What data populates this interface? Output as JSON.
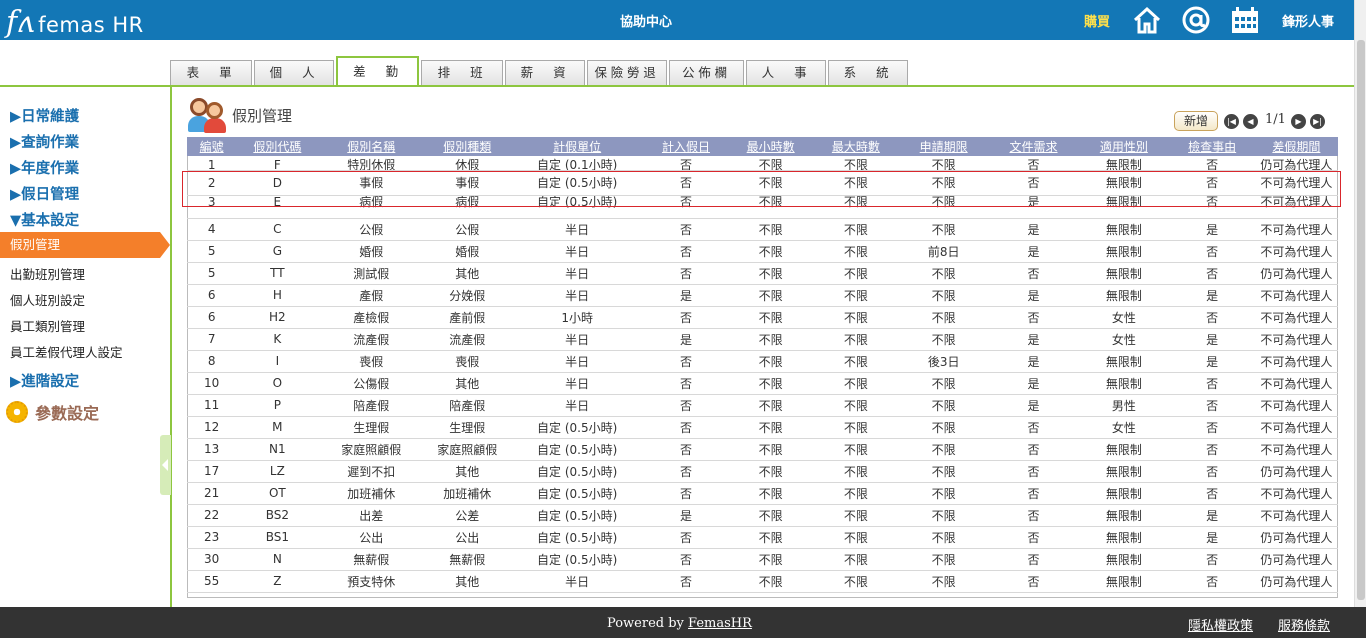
{
  "header": {
    "logo_mark": "fʌ",
    "logo_text": "femas HR",
    "help_center": "協助中心",
    "buy": "購買",
    "company": "鋒形人事"
  },
  "tabs": [
    "表　單",
    "個　人",
    "差　勤",
    "排　班",
    "薪　資",
    "保險勞退",
    "公佈欄",
    "人　事",
    "系　統"
  ],
  "sidebar": {
    "menus": [
      "▶日常維護",
      "▶查詢作業",
      "▶年度作業",
      "▶假日管理",
      "▼基本設定"
    ],
    "subs": [
      "假別管理",
      "出勤班別管理",
      "個人班別設定",
      "員工類別管理",
      "員工差假代理人設定"
    ],
    "advanced": "▶進階設定",
    "params": "參數設定"
  },
  "main": {
    "title": "假別管理",
    "add_button": "新增",
    "page_indicator": "1/1",
    "pager_icons": [
      "first-page-icon",
      "prev-page-icon",
      "next-page-icon",
      "last-page-icon"
    ]
  },
  "table": {
    "headers": [
      "編號",
      "假別代碼",
      "假別名稱",
      "假別種類",
      "計假單位",
      "計入假日",
      "最小時數",
      "最大時數",
      "申請期限",
      "文件需求",
      "適用性別",
      "檢查事由",
      "差假期間"
    ],
    "rows": [
      [
        "1",
        "F",
        "特別休假",
        "休假",
        "自定 (0.1小時)",
        "否",
        "不限",
        "不限",
        "不限",
        "否",
        "無限制",
        "否",
        "仍可為代理人"
      ],
      [
        "2",
        "D",
        "事假",
        "事假",
        "自定 (0.5小時)",
        "否",
        "不限",
        "不限",
        "不限",
        "否",
        "無限制",
        "否",
        "不可為代理人"
      ],
      [
        "3",
        "E",
        "病假",
        "病假",
        "自定 (0.5小時)",
        "否",
        "不限",
        "不限",
        "不限",
        "是",
        "無限制",
        "否",
        "不可為代理人"
      ],
      [
        "4",
        "C",
        "公假",
        "公假",
        "半日",
        "否",
        "不限",
        "不限",
        "不限",
        "是",
        "無限制",
        "是",
        "不可為代理人"
      ],
      [
        "5",
        "G",
        "婚假",
        "婚假",
        "半日",
        "否",
        "不限",
        "不限",
        "前8日",
        "是",
        "無限制",
        "否",
        "不可為代理人"
      ],
      [
        "5",
        "TT",
        "測試假",
        "其他",
        "半日",
        "否",
        "不限",
        "不限",
        "不限",
        "否",
        "無限制",
        "否",
        "仍可為代理人"
      ],
      [
        "6",
        "H",
        "產假",
        "分娩假",
        "半日",
        "是",
        "不限",
        "不限",
        "不限",
        "是",
        "無限制",
        "是",
        "不可為代理人"
      ],
      [
        "6",
        "H2",
        "產檢假",
        "產前假",
        "1小時",
        "否",
        "不限",
        "不限",
        "不限",
        "否",
        "女性",
        "否",
        "不可為代理人"
      ],
      [
        "7",
        "K",
        "流產假",
        "流產假",
        "半日",
        "是",
        "不限",
        "不限",
        "不限",
        "是",
        "女性",
        "是",
        "不可為代理人"
      ],
      [
        "8",
        "I",
        "喪假",
        "喪假",
        "半日",
        "否",
        "不限",
        "不限",
        "後3日",
        "是",
        "無限制",
        "是",
        "不可為代理人"
      ],
      [
        "10",
        "O",
        "公傷假",
        "其他",
        "半日",
        "否",
        "不限",
        "不限",
        "不限",
        "是",
        "無限制",
        "否",
        "不可為代理人"
      ],
      [
        "11",
        "P",
        "陪產假",
        "陪產假",
        "半日",
        "否",
        "不限",
        "不限",
        "不限",
        "是",
        "男性",
        "否",
        "不可為代理人"
      ],
      [
        "12",
        "M",
        "生理假",
        "生理假",
        "自定 (0.5小時)",
        "否",
        "不限",
        "不限",
        "不限",
        "否",
        "女性",
        "否",
        "不可為代理人"
      ],
      [
        "13",
        "N1",
        "家庭照顧假",
        "家庭照顧假",
        "自定 (0.5小時)",
        "否",
        "不限",
        "不限",
        "不限",
        "否",
        "無限制",
        "否",
        "不可為代理人"
      ],
      [
        "17",
        "LZ",
        "遲到不扣",
        "其他",
        "自定 (0.5小時)",
        "否",
        "不限",
        "不限",
        "不限",
        "否",
        "無限制",
        "否",
        "仍可為代理人"
      ],
      [
        "21",
        "OT",
        "加班補休",
        "加班補休",
        "自定 (0.5小時)",
        "否",
        "不限",
        "不限",
        "不限",
        "否",
        "無限制",
        "否",
        "不可為代理人"
      ],
      [
        "22",
        "BS2",
        "出差",
        "公差",
        "自定 (0.5小時)",
        "是",
        "不限",
        "不限",
        "不限",
        "否",
        "無限制",
        "是",
        "不可為代理人"
      ],
      [
        "23",
        "BS1",
        "公出",
        "公出",
        "自定 (0.5小時)",
        "否",
        "不限",
        "不限",
        "不限",
        "否",
        "無限制",
        "是",
        "仍可為代理人"
      ],
      [
        "30",
        "N",
        "無薪假",
        "無薪假",
        "自定 (0.5小時)",
        "否",
        "不限",
        "不限",
        "不限",
        "否",
        "無限制",
        "否",
        "仍可為代理人"
      ],
      [
        "55",
        "Z",
        "預支特休",
        "其他",
        "半日",
        "否",
        "不限",
        "不限",
        "不限",
        "否",
        "無限制",
        "否",
        "仍可為代理人"
      ]
    ]
  },
  "footer": {
    "powered_prefix": "Powered by ",
    "powered_link": "FemasHR",
    "privacy": "隱私權政策",
    "terms": "服務條款"
  },
  "colors": {
    "header_bg": "#1377b6",
    "accent_green": "#8dc63f",
    "active_orange": "#f47f2a",
    "table_header": "#8d97bf",
    "highlight_red": "#d9262c"
  }
}
